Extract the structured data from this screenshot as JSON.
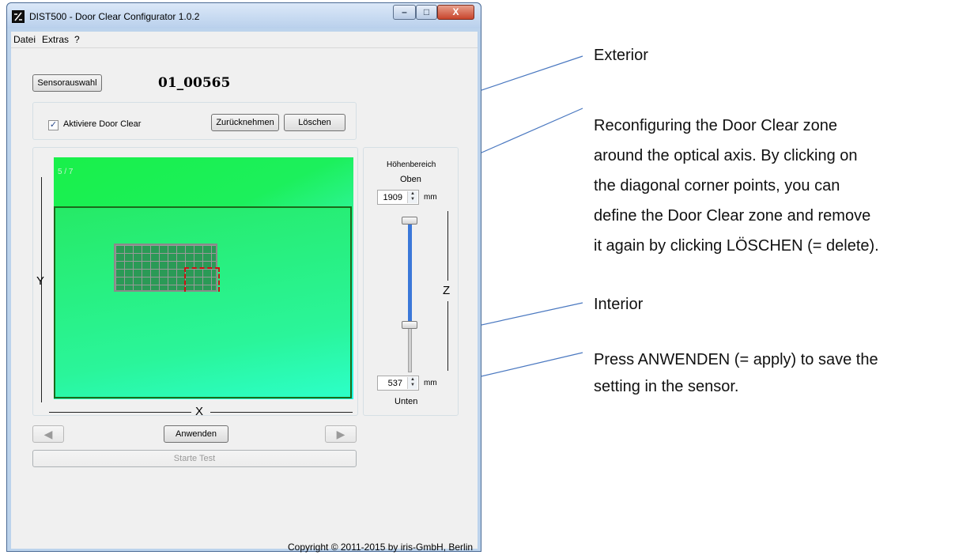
{
  "window": {
    "title": "DIST500 - Door Clear Configurator 1.0.2",
    "minimize_label": "–",
    "maximize_label": "□",
    "close_label": "X"
  },
  "menu": {
    "items": [
      "Datei",
      "Extras",
      "?"
    ]
  },
  "toolbar": {
    "sensor_select_label": "Sensorauswahl",
    "sensor_id": "01_00565"
  },
  "door_clear": {
    "activate_label": "Aktiviere Door Clear",
    "activate_checked": true,
    "undo_label": "Zurücknehmen",
    "delete_label": "Löschen"
  },
  "view": {
    "frame_label": "5 / 7",
    "x_axis_label": "X",
    "y_axis_label": "Y",
    "z_axis_label": "Z"
  },
  "height_range": {
    "title": "Höhenbereich",
    "top_label": "Oben",
    "top_value": "1909",
    "bottom_label": "Unten",
    "bottom_value": "537",
    "unit": "mm"
  },
  "actions": {
    "prev_icon": "left-arrow-icon",
    "next_icon": "right-arrow-icon",
    "apply_label": "Anwenden",
    "start_test_label": "Starte Test"
  },
  "footer": {
    "copyright": "Copyright © 2011-2015 by iris-GmbH, Berlin"
  },
  "annotations": {
    "exterior": "Exterior",
    "reconfigure": [
      "Reconfiguring the Door Clear zone",
      "around the optical axis.  By clicking on",
      "the diagonal corner points, you can",
      "define the Door Clear zone and remove",
      "it again by clicking LÖSCHEN (= delete)."
    ],
    "interior": "Interior",
    "apply_note": [
      "Press ANWENDEN (= apply) to save the",
      "setting in the sensor."
    ],
    "line_color": "#4a78c0"
  }
}
